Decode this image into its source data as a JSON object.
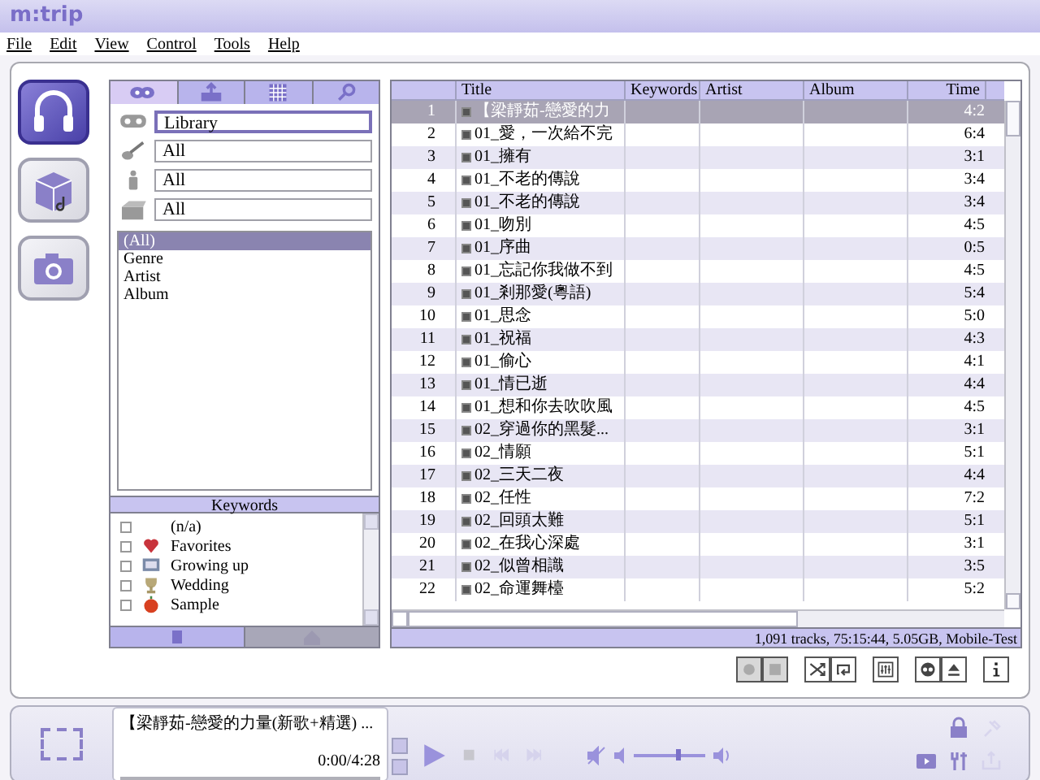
{
  "app": {
    "logo": "m:trip"
  },
  "menu": [
    "File",
    "Edit",
    "View",
    "Control",
    "Tools",
    "Help"
  ],
  "mode_buttons": [
    {
      "kind": "headphones",
      "selected": true
    },
    {
      "kind": "cube",
      "selected": false
    },
    {
      "kind": "camera",
      "selected": false
    }
  ],
  "browser": {
    "tabs": [
      {
        "kind": "disc",
        "selected": true
      },
      {
        "kind": "upload",
        "selected": false
      },
      {
        "kind": "grid",
        "selected": false
      },
      {
        "kind": "search",
        "selected": false
      }
    ],
    "filters": [
      {
        "kind": "tape",
        "value": "Library",
        "selected": true
      },
      {
        "kind": "guitar",
        "value": "All",
        "selected": false
      },
      {
        "kind": "person",
        "value": "All",
        "selected": false
      },
      {
        "kind": "box",
        "value": "All",
        "selected": false
      }
    ],
    "categories": [
      {
        "label": "(All)",
        "selected": true
      },
      {
        "label": "Genre",
        "selected": false
      },
      {
        "label": "Artist",
        "selected": false
      },
      {
        "label": "Album",
        "selected": false
      }
    ],
    "keywords": {
      "title": "Keywords",
      "items": [
        {
          "kind": "none",
          "label": "(n/a)",
          "checked": false
        },
        {
          "kind": "heart",
          "label": "Favorites",
          "checked": false
        },
        {
          "kind": "photo",
          "label": "Growing up",
          "checked": false
        },
        {
          "kind": "trophy",
          "label": "Wedding",
          "checked": false
        },
        {
          "kind": "apple",
          "label": "Sample",
          "checked": false
        }
      ]
    },
    "bottom_buttons": [
      {
        "kind": "add",
        "disabled": false
      },
      {
        "kind": "home",
        "disabled": true
      }
    ]
  },
  "tracks": {
    "columns": [
      "Title",
      "Keywords",
      "Artist",
      "Album",
      "Time"
    ],
    "rows": [
      {
        "number": "1",
        "title": "【梁靜茹-戀愛的力",
        "checked": true,
        "time": "4:2",
        "selected": true
      },
      {
        "number": "2",
        "title": "01_愛，一次給不完",
        "checked": true,
        "time": "6:4",
        "selected": false
      },
      {
        "number": "3",
        "title": "01_擁有",
        "checked": true,
        "time": "3:1",
        "selected": false
      },
      {
        "number": "4",
        "title": "01_不老的傳說",
        "checked": true,
        "time": "3:4",
        "selected": false
      },
      {
        "number": "5",
        "title": "01_不老的傳說",
        "checked": true,
        "time": "3:4",
        "selected": false
      },
      {
        "number": "6",
        "title": "01_吻別",
        "checked": true,
        "time": "4:5",
        "selected": false
      },
      {
        "number": "7",
        "title": "01_序曲",
        "checked": true,
        "time": "0:5",
        "selected": false
      },
      {
        "number": "8",
        "title": "01_忘記你我做不到",
        "checked": true,
        "time": "4:5",
        "selected": false
      },
      {
        "number": "9",
        "title": "01_剎那愛(粵語)",
        "checked": true,
        "time": "5:4",
        "selected": false
      },
      {
        "number": "10",
        "title": "01_思念",
        "checked": true,
        "time": "5:0",
        "selected": false
      },
      {
        "number": "11",
        "title": "01_祝福",
        "checked": true,
        "time": "4:3",
        "selected": false
      },
      {
        "number": "12",
        "title": "01_偷心",
        "checked": true,
        "time": "4:1",
        "selected": false
      },
      {
        "number": "13",
        "title": "01_情已逝",
        "checked": true,
        "time": "4:4",
        "selected": false
      },
      {
        "number": "14",
        "title": "01_想和你去吹吹風",
        "checked": true,
        "time": "4:5",
        "selected": false
      },
      {
        "number": "15",
        "title": "02_穿過你的黑髮...",
        "checked": true,
        "time": "3:1",
        "selected": false
      },
      {
        "number": "16",
        "title": "02_情願",
        "checked": true,
        "time": "5:1",
        "selected": false
      },
      {
        "number": "17",
        "title": "02_三天二夜",
        "checked": true,
        "time": "4:4",
        "selected": false
      },
      {
        "number": "18",
        "title": "02_任性",
        "checked": true,
        "time": "7:2",
        "selected": false
      },
      {
        "number": "19",
        "title": "02_回頭太難",
        "checked": true,
        "time": "5:1",
        "selected": false
      },
      {
        "number": "20",
        "title": "02_在我心深處",
        "checked": true,
        "time": "3:1",
        "selected": false
      },
      {
        "number": "21",
        "title": "02_似曾相識",
        "checked": true,
        "time": "3:5",
        "selected": false
      },
      {
        "number": "22",
        "title": "02_命運舞檯",
        "checked": true,
        "time": "5:2",
        "selected": false
      }
    ],
    "status": "1,091 tracks, 75:15:44, 5.05GB, Mobile-Test"
  },
  "toolbar": [
    {
      "buttons": [
        {
          "kind": "record",
          "disabled": true
        },
        {
          "kind": "stop",
          "disabled": true
        }
      ]
    },
    {
      "buttons": [
        {
          "kind": "shuffle",
          "disabled": false
        },
        {
          "kind": "repeat",
          "disabled": false
        }
      ]
    },
    {
      "buttons": [
        {
          "kind": "equalizer",
          "disabled": false
        }
      ]
    },
    {
      "buttons": [
        {
          "kind": "cd",
          "disabled": false
        },
        {
          "kind": "eject",
          "disabled": false
        }
      ]
    },
    {
      "buttons": [
        {
          "kind": "info",
          "disabled": false
        }
      ]
    }
  ],
  "player": {
    "now_playing": "【梁靜茹-戀愛的力量(新歌+精選) ...",
    "time": "0:00/4:28",
    "progress": {
      "level": 0
    },
    "transport": [
      {
        "kind": "play",
        "disabled": false
      },
      {
        "kind": "stop",
        "disabled": true
      },
      {
        "kind": "prev",
        "disabled": true
      },
      {
        "kind": "next",
        "disabled": true
      }
    ],
    "volume": {
      "level": 0.6
    },
    "side_icons": [
      {
        "kind": "lock",
        "disabled": false
      },
      {
        "kind": "pin",
        "disabled": true
      },
      {
        "kind": "screen",
        "disabled": false
      },
      {
        "kind": "tools",
        "disabled": false
      },
      {
        "kind": "export",
        "disabled": true
      }
    ]
  }
}
